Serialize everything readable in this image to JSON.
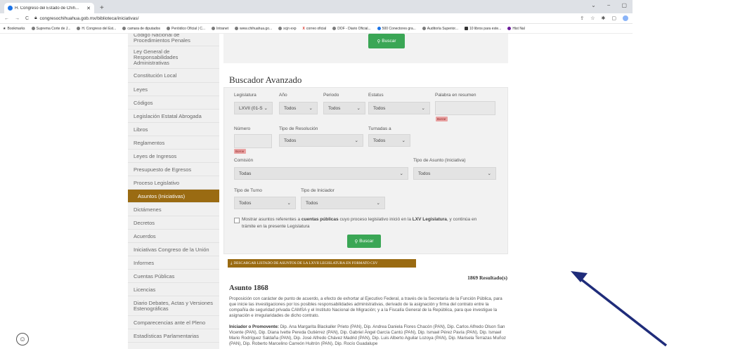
{
  "browser": {
    "tab_title": "H. Congreso del Estado de Chih...",
    "new_tab": "+",
    "url": "congresochihuahua.gob.mx/biblioteca/iniciativas/",
    "window_controls": [
      "⌄",
      "−",
      "▢"
    ],
    "bookmarks": [
      "Bookmarks",
      "Suprema Corte de J...",
      "H. Congreso del Est...",
      "camara de diputados",
      "Periódico Oficial | C...",
      "Intranet",
      "www.chihuahua.go...",
      "scjn exp",
      "correo oficial",
      "DOF - Diario Oficial...",
      "500 Conectores gra...",
      "Auditoría Superior...",
      "10 libros para este...",
      "Hist Nal"
    ]
  },
  "sidebar": {
    "items": [
      "Código Nacional de Procedimientos Penales",
      "Ley General de Responsabilidades Administrativas",
      "Constitución Local",
      "Leyes",
      "Códigos",
      "Legislación Estatal Abrogada",
      "Libros",
      "Reglamentos",
      "Leyes de Ingresos",
      "Presupuesto de Egresos",
      "Proceso Legislativo",
      "Asuntos (Iniciativas)",
      "Dictámenes",
      "Decretos",
      "Acuerdos",
      "Iniciativas Congreso de la Unión",
      "Informes",
      "Cuentas Públicas",
      "Licencias",
      "Diario Debates, Actas y Versiones Estenográficas",
      "Comparecencias ante el Pleno",
      "Estadísticas Parlamentarias"
    ],
    "active_index": 11
  },
  "top": {
    "search_button": "Buscar"
  },
  "form": {
    "title": "Buscador Avanzado",
    "legislatura_label": "Legislatura",
    "legislatura_value": "LXVII (01-S",
    "anio_label": "Año",
    "anio_value": "Todos",
    "periodo_label": "Periodo",
    "periodo_value": "Todos",
    "estatus_label": "Estatus",
    "estatus_value": "Todos",
    "palabra_label": "Palabra en resumen",
    "borrar": "Borrar",
    "numero_label": "Número",
    "tipo_resolucion_label": "Tipo de Resolución",
    "tipo_resolucion_value": "Todos",
    "turnadas_label": "Turnadas a",
    "turnadas_value": "Todos",
    "comision_label": "Comisión",
    "comision_value": "Todas",
    "tipo_asunto_label": "Tipo de Asunto (Iniciativa)",
    "tipo_asunto_value": "Todos",
    "tipo_turno_label": "Tipo de Turno",
    "tipo_turno_value": "Todos",
    "tipo_iniciador_label": "Tipo de Iniciador",
    "tipo_iniciador_value": "Todos",
    "chk_pre": "Mostrar asuntos referentes a ",
    "chk_bold1": "cuentas públicas",
    "chk_mid": " cuyo proceso legislativo inició en la ",
    "chk_bold2": "LXV Legislatura",
    "chk_post": ", y continúa en trámite en la presente Legislatura",
    "search_button": "Buscar"
  },
  "download_label": "DESCARGAR LISTADO DE ASUNTOS DE LA LXVII LEGISLATURA EN FORMATO CSV",
  "results_label": "1869 Resultado(s)",
  "asunto": {
    "title": "Asunto 1868",
    "description": "Proposición con carácter de punto de acuerdo, a efecto de exhortar al Ejecutivo Federal, a través de la Secretaría de la Función Pública, para que inicie las investigaciones por los posibles responsabilidades administrativas, derivado de la asignación y firma del contrato entre la compañía de seguridad privada CAMSA y el Instituto Nacional de Migración; y a la Fiscalía General de la República, para que investigue la asignación e irregularidades de dicho contrato.",
    "iniciador_label": "Iniciador o Promovente:",
    "iniciador_value": "Dip. Ana Margarita Blackaller Prieto (PAN), Dip. Andrea Daniela Flores Chacón (PAN), Dip. Carlos Alfredo Olson San Vicente (PAN), Dip. Diana Ivette Pereda Gutiérrez (PAN), Dip. Gabriel Ángel García Cantú (PAN), Dip. Ismael Pérez Pavía (PAN), Dip. Ismael Mario Rodríguez Saldaña (PAN), Dip. José Alfredo Chávez Madrid (PAN), Dip. Luis Alberto Aguilar Lozoya (PAN), Dip. Marisela Terrazas Muñoz (PAN), Dip. Roberto Marcelino Carreón Huitrón (PAN), Dip. Rocío Guadalupe"
  }
}
